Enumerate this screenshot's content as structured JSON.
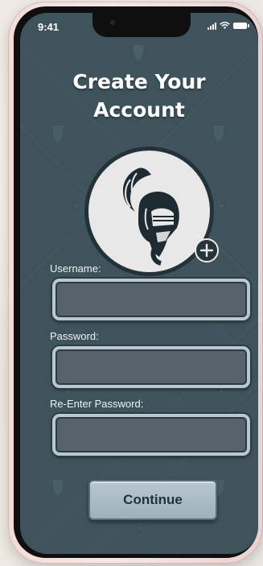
{
  "status_bar": {
    "time": "9:41"
  },
  "header": {
    "title_line1": "Create Your",
    "title_line2": "Account"
  },
  "avatar": {
    "icon": "knight-helmet-icon",
    "add_icon": "plus-circle-icon"
  },
  "form": {
    "username_label": "Username:",
    "password_label": "Password:",
    "reenter_label": "Re-Enter Password:",
    "username_value": "",
    "password_value": "",
    "reenter_value": ""
  },
  "actions": {
    "continue_label": "Continue"
  },
  "colors": {
    "screen_bg": "#3e535b",
    "input_border": "#b9c8d0",
    "button_bg": "#a9bac3"
  }
}
